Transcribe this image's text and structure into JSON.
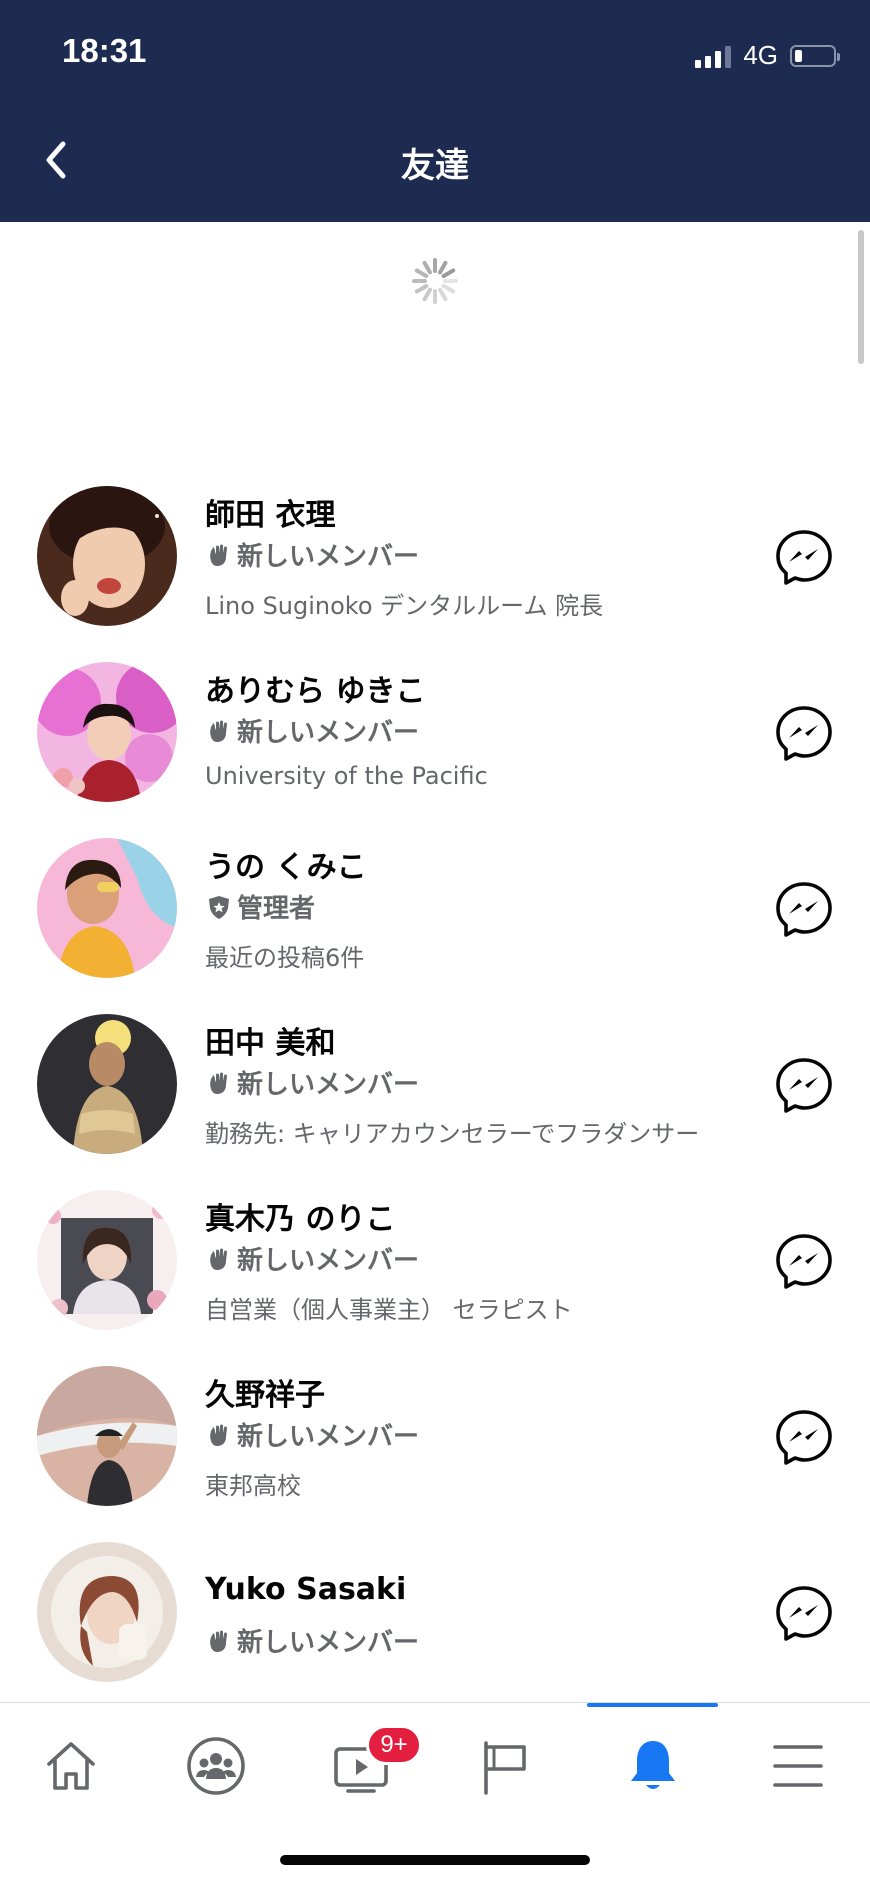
{
  "status_bar": {
    "time": "18:31",
    "network": "4G",
    "battery_level": 0.2
  },
  "header": {
    "title": "友達"
  },
  "colors": {
    "header_bg": "#1e2b50",
    "accent": "#1877f2",
    "badge_red": "#e41e3f",
    "secondary_text": "#65676b"
  },
  "members": [
    {
      "name": "師田 衣理",
      "badge_icon": "wave-icon",
      "badge": "新しいメンバー",
      "detail": "Lino Suginoko デンタルルーム 院長"
    },
    {
      "name": "ありむら ゆきこ",
      "badge_icon": "wave-icon",
      "badge": "新しいメンバー",
      "detail": "University of the Pacific"
    },
    {
      "name": "うの くみこ",
      "badge_icon": "admin-shield-icon",
      "badge": "管理者",
      "detail": "最近の投稿6件"
    },
    {
      "name": "田中 美和",
      "badge_icon": "wave-icon",
      "badge": "新しいメンバー",
      "detail": "勤務先: キャリアカウンセラーでフラダンサー"
    },
    {
      "name": "真木乃 のりこ",
      "badge_icon": "wave-icon",
      "badge": "新しいメンバー",
      "detail": "自営業（個人事業主） セラピスト"
    },
    {
      "name": "久野祥子",
      "badge_icon": "wave-icon",
      "badge": "新しいメンバー",
      "detail": "東邦高校"
    },
    {
      "name": "Yuko Sasaki",
      "badge_icon": "wave-icon",
      "badge": "新しいメンバー",
      "detail": ""
    }
  ],
  "tabbar": {
    "tabs": [
      {
        "icon": "home-icon"
      },
      {
        "icon": "groups-icon"
      },
      {
        "icon": "watch-video-icon",
        "badge": "9+"
      },
      {
        "icon": "pages-flag-icon"
      },
      {
        "icon": "notifications-bell-icon",
        "active": true
      },
      {
        "icon": "menu-icon"
      }
    ]
  }
}
